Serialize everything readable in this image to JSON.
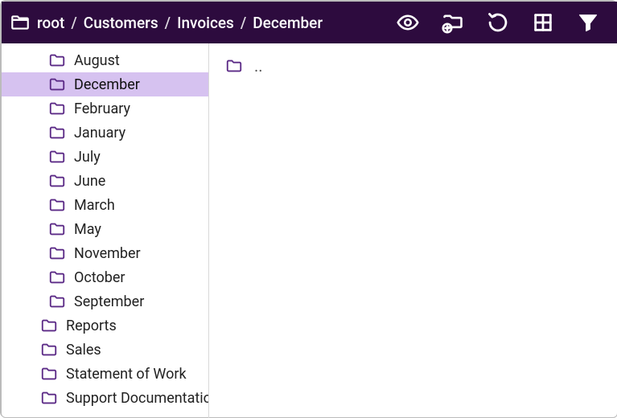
{
  "toolbar": {
    "root_label": "root",
    "breadcrumb": [
      "Customers",
      "Invoices",
      "December"
    ]
  },
  "colors": {
    "toolbar_bg": "#2d0b3e",
    "folder_stroke": "#5b2a86",
    "selected_bg": "#d6c2f0"
  },
  "sidebar": {
    "selected": "December",
    "items": [
      {
        "label": "August",
        "depth": 2
      },
      {
        "label": "December",
        "depth": 2
      },
      {
        "label": "February",
        "depth": 2
      },
      {
        "label": "January",
        "depth": 2
      },
      {
        "label": "July",
        "depth": 2
      },
      {
        "label": "June",
        "depth": 2
      },
      {
        "label": "March",
        "depth": 2
      },
      {
        "label": "May",
        "depth": 2
      },
      {
        "label": "November",
        "depth": 2
      },
      {
        "label": "October",
        "depth": 2
      },
      {
        "label": "September",
        "depth": 2
      },
      {
        "label": "Reports",
        "depth": 1
      },
      {
        "label": "Sales",
        "depth": 1
      },
      {
        "label": "Statement of Work",
        "depth": 1
      },
      {
        "label": "Support Documentation",
        "depth": 1
      }
    ]
  },
  "content": {
    "items": [
      {
        "label": ".."
      }
    ]
  }
}
